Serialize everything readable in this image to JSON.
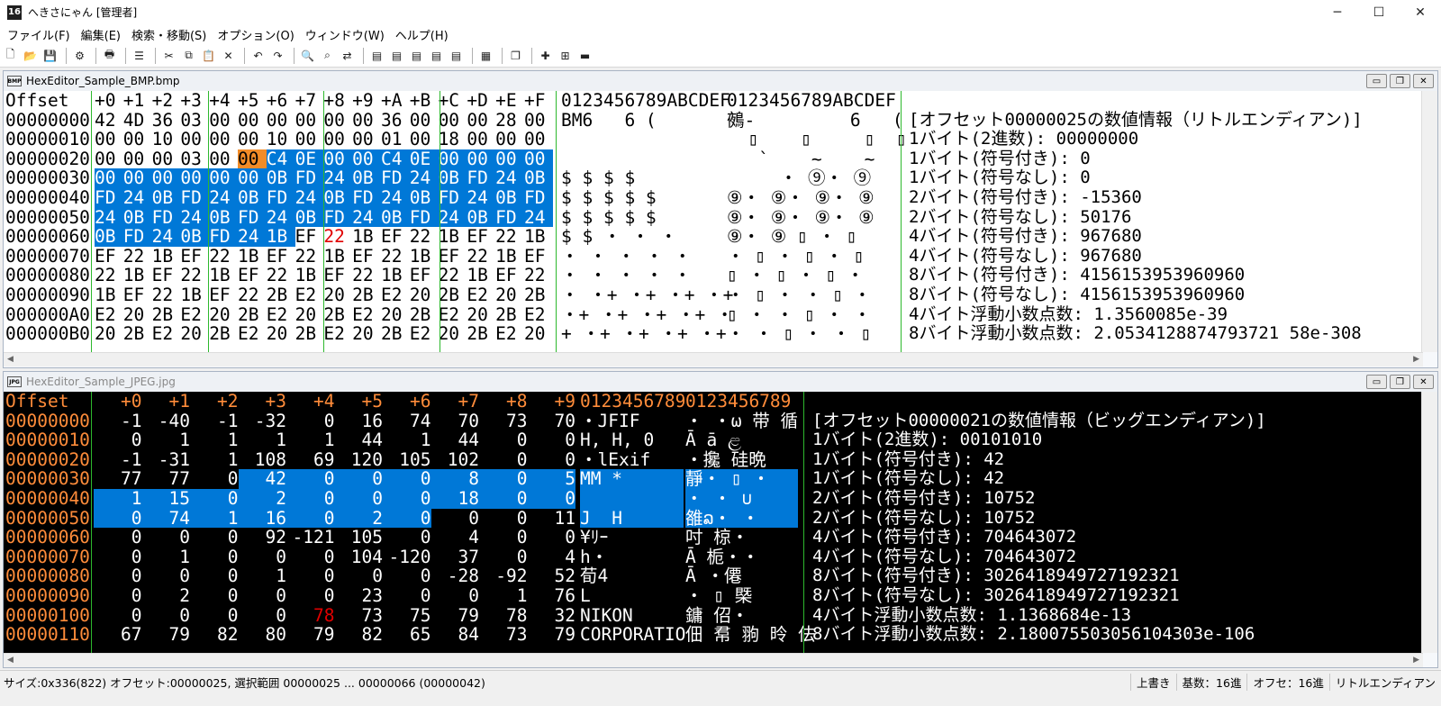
{
  "app": {
    "title": "へきさにゃん [管理者]",
    "icon_text": "16"
  },
  "window_controls": {
    "minimize": "─",
    "maximize": "☐",
    "close": "✕"
  },
  "menu": [
    "ファイル(F)",
    "編集(E)",
    "検索・移動(S)",
    "オプション(O)",
    "ウィンドウ(W)",
    "ヘルプ(H)"
  ],
  "toolbar_icons": [
    "new-file-icon",
    "open-folder-icon",
    "save-icon",
    "sep",
    "properties-icon",
    "sep",
    "print-icon",
    "sep",
    "list-icon",
    "sep",
    "cut-icon",
    "copy-icon",
    "paste-icon",
    "delete-icon",
    "sep",
    "undo-icon",
    "redo-icon",
    "sep",
    "find-icon",
    "find-next-icon",
    "replace-icon",
    "sep",
    "page-icon",
    "page-icon",
    "page-icon",
    "page-icon",
    "page-icon",
    "sep",
    "layout-icon",
    "sep",
    "windows-icon",
    "sep",
    "plus-icon",
    "plus-box-icon",
    "window-icon"
  ],
  "bmp": {
    "title": "HexEditor_Sample_BMP.bmp",
    "icon_text": "BMP",
    "header": {
      "offset": "Offset",
      "cols": [
        "+0",
        "+1",
        "+2",
        "+3",
        "+4",
        "+5",
        "+6",
        "+7",
        "+8",
        "+9",
        "+A",
        "+B",
        "+C",
        "+D",
        "+E",
        "+F"
      ],
      "ascii1": "0123456789ABCDEF",
      "ascii2": "0123456789ABCDEF"
    },
    "rows": [
      {
        "off": "00000000",
        "hex": [
          "42",
          "4D",
          "36",
          "03",
          "00",
          "00",
          "00",
          "00",
          "00",
          "00",
          "36",
          "00",
          "00",
          "00",
          "28",
          "00"
        ],
        "a1": "BM6   6 (",
        "a2": "鵺-         6   ("
      },
      {
        "off": "00000010",
        "hex": [
          "00",
          "00",
          "10",
          "00",
          "00",
          "00",
          "10",
          "00",
          "00",
          "00",
          "01",
          "00",
          "18",
          "00",
          "00",
          "00"
        ],
        "a1": "  ",
        "a2": "  ▯    ▯     ▯  ▯"
      },
      {
        "off": "00000020",
        "hex": [
          "00",
          "00",
          "00",
          "03",
          "00",
          "00",
          "C4",
          "0E",
          "00",
          "00",
          "C4",
          "0E",
          "00",
          "00",
          "00",
          "00"
        ],
        "a1": "  ",
        "a2": "   `    ~    ~"
      },
      {
        "off": "00000030",
        "hex": [
          "00",
          "00",
          "00",
          "00",
          "00",
          "00",
          "0B",
          "FD",
          "24",
          "0B",
          "FD",
          "24",
          "0B",
          "FD",
          "24",
          "0B"
        ],
        "a1": "$ $ $ $",
        "a2": "     ・ ⑨・ ⑨"
      },
      {
        "off": "00000040",
        "hex": [
          "FD",
          "24",
          "0B",
          "FD",
          "24",
          "0B",
          "FD",
          "24",
          "0B",
          "FD",
          "24",
          "0B",
          "FD",
          "24",
          "0B",
          "FD"
        ],
        "a1": "$ $ $ $ $",
        "a2": "⑨・ ⑨・ ⑨・ ⑨"
      },
      {
        "off": "00000050",
        "hex": [
          "24",
          "0B",
          "FD",
          "24",
          "0B",
          "FD",
          "24",
          "0B",
          "FD",
          "24",
          "0B",
          "FD",
          "24",
          "0B",
          "FD",
          "24"
        ],
        "a1": "$ $ $ $ $",
        "a2": "⑨・ ⑨・ ⑨・ ⑨"
      },
      {
        "off": "00000060",
        "hex": [
          "0B",
          "FD",
          "24",
          "0B",
          "FD",
          "24",
          "1B",
          "EF",
          "22",
          "1B",
          "EF",
          "22",
          "1B",
          "EF",
          "22",
          "1B"
        ],
        "a1": "$ $ ・ ・ ・",
        "a2": "⑨・ ⑨ ▯ ・ ▯"
      },
      {
        "off": "00000070",
        "hex": [
          "EF",
          "22",
          "1B",
          "EF",
          "22",
          "1B",
          "EF",
          "22",
          "1B",
          "EF",
          "22",
          "1B",
          "EF",
          "22",
          "1B",
          "EF"
        ],
        "a1": "・ ・ ・ ・ ・",
        "a2": "・ ▯ ・ ▯ ・ ▯"
      },
      {
        "off": "00000080",
        "hex": [
          "22",
          "1B",
          "EF",
          "22",
          "1B",
          "EF",
          "22",
          "1B",
          "EF",
          "22",
          "1B",
          "EF",
          "22",
          "1B",
          "EF",
          "22"
        ],
        "a1": "・ ・ ・ ・ ・",
        "a2": "▯ ・ ▯ ・ ▯ ・"
      },
      {
        "off": "00000090",
        "hex": [
          "1B",
          "EF",
          "22",
          "1B",
          "EF",
          "22",
          "2B",
          "E2",
          "20",
          "2B",
          "E2",
          "20",
          "2B",
          "E2",
          "20",
          "2B"
        ],
        "a1": "・ ・+ ・+ ・+ ・+",
        "a2": "・ ▯ ・ ・ ▯ ・"
      },
      {
        "off": "000000A0",
        "hex": [
          "E2",
          "20",
          "2B",
          "E2",
          "20",
          "2B",
          "E2",
          "20",
          "2B",
          "E2",
          "20",
          "2B",
          "E2",
          "20",
          "2B",
          "E2"
        ],
        "a1": "・+ ・+ ・+ ・+ ・",
        "a2": "▯ ・ ・ ▯ ・ ・"
      },
      {
        "off": "000000B0",
        "hex": [
          "20",
          "2B",
          "E2",
          "20",
          "2B",
          "E2",
          "20",
          "2B",
          "E2",
          "20",
          "2B",
          "E2",
          "20",
          "2B",
          "E2",
          "20"
        ],
        "a1": "+ ・+ ・+ ・+ ・+",
        "a2": "・ ・ ▯ ・ ・ ▯"
      }
    ],
    "info": [
      "[オフセット00000025の数値情報（リトルエンディアン)]",
      "1バイト(2進数): 00000000",
      "1バイト(符号付き): 0",
      "1バイト(符号なし): 0",
      "2バイト(符号付き): -15360",
      "2バイト(符号なし): 50176",
      "4バイト(符号付き): 967680",
      "4バイト(符号なし): 967680",
      "8バイト(符号付き): 4156153953960960",
      "8バイト(符号なし): 4156153953960960",
      "4バイト浮動小数点数: 1.3560085e-39",
      "8バイト浮動小数点数: 2.0534128874793721 58e-308"
    ]
  },
  "jpg": {
    "title": "HexEditor_Sample_JPEG.jpg",
    "icon_text": "JPG",
    "header": {
      "offset": "Offset",
      "cols": [
        "+0",
        "+1",
        "+2",
        "+3",
        "+4",
        "+5",
        "+6",
        "+7",
        "+8",
        "+9"
      ],
      "ascii1": "0123456789",
      "ascii2": "0123456789"
    },
    "rows": [
      {
        "off": "00000000",
        "dec": [
          "-1",
          "-40",
          "-1",
          "-32",
          "0",
          "16",
          "74",
          "70",
          "73",
          "70"
        ],
        "a1": "・JFIF",
        "a2": "・ ・ω 带 循"
      },
      {
        "off": "00000010",
        "dec": [
          "0",
          "1",
          "1",
          "1",
          "1",
          "44",
          "1",
          "44",
          "0",
          "0"
        ],
        "a1": "H, H, 0",
        "a2": "Ā ā ළ"
      },
      {
        "off": "00000020",
        "dec": [
          "-1",
          "-31",
          "1",
          "108",
          "69",
          "120",
          "105",
          "102",
          "0",
          "0"
        ],
        "a1": "・lExif",
        "a2": "・攙 硅晩"
      },
      {
        "off": "00000030",
        "dec": [
          "77",
          "77",
          "0",
          "42",
          "0",
          "0",
          "0",
          "8",
          "0",
          "5"
        ],
        "a1": "MM *",
        "a2": "靜・ ▯ ・"
      },
      {
        "off": "00000040",
        "dec": [
          "1",
          "15",
          "0",
          "2",
          "0",
          "0",
          "0",
          "18",
          "0",
          "0"
        ],
        "a1": "",
        "a2": "・ ・ ∪"
      },
      {
        "off": "00000050",
        "dec": [
          "0",
          "74",
          "1",
          "16",
          "0",
          "2",
          "0",
          "0",
          "0",
          "11"
        ],
        "a1": "J  H",
        "a2": "雒ລ・ ・"
      },
      {
        "off": "00000060",
        "dec": [
          "0",
          "0",
          "0",
          "92",
          "-121",
          "105",
          "0",
          "4",
          "0",
          "0"
        ],
        "a1": "¥ﾘｰ",
        "a2": "吋 椋・"
      },
      {
        "off": "00000070",
        "dec": [
          "0",
          "1",
          "0",
          "0",
          "0",
          "104",
          "-120",
          "37",
          "0",
          "4"
        ],
        "a1": "h・",
        "a2": "Ā 栀・・"
      },
      {
        "off": "00000080",
        "dec": [
          "0",
          "0",
          "0",
          "1",
          "0",
          "0",
          "0",
          "-28",
          "-92",
          "52"
        ],
        "a1": "荀4",
        "a2": "Ā ・僊"
      },
      {
        "off": "00000090",
        "dec": [
          "0",
          "2",
          "0",
          "0",
          "0",
          "23",
          "0",
          "0",
          "1",
          "76"
        ],
        "a1": "L",
        "a2": "・ ▯ 槩"
      },
      {
        "off": "00000100",
        "dec": [
          "0",
          "0",
          "0",
          "0",
          "78",
          "73",
          "75",
          "79",
          "78",
          "32"
        ],
        "a1": "NIKON",
        "a2": "鏞 佋・"
      },
      {
        "off": "00000110",
        "dec": [
          "67",
          "79",
          "82",
          "80",
          "79",
          "82",
          "65",
          "84",
          "73",
          "79"
        ],
        "a1": "CORPORATIO",
        "a2": "佃 帬 翑 昤 佉"
      }
    ],
    "info": [
      "[オフセット00000021の数値情報（ビッグエンディアン)]",
      "1バイト(2進数): 00101010",
      "1バイト(符号付き): 42",
      "1バイト(符号なし): 42",
      "2バイト(符号付き): 10752",
      "2バイト(符号なし): 10752",
      "4バイト(符号付き): 704643072",
      "4バイト(符号なし): 704643072",
      "8バイト(符号付き): 3026418949727192321",
      "8バイト(符号なし): 3026418949727192321",
      "4バイト浮動小数点数: 1.1368684e-13",
      "8バイト浮動小数点数: 2.180075503056104303e-106"
    ]
  },
  "status": {
    "main": "サイズ:0x336(822) オフセット:00000025, 選択範囲 00000025 ... 00000066 (00000042)",
    "mode": "上書き",
    "radix": "基数：16進",
    "offset_radix": "オフセ：16進",
    "endian": "リトルエンディアン"
  }
}
